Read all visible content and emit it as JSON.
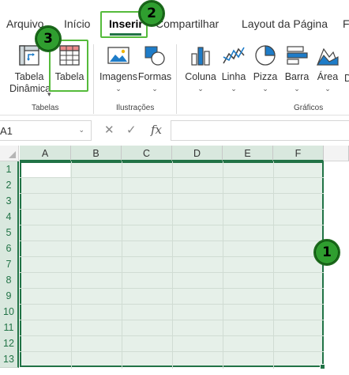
{
  "menu": {
    "tabs": [
      "Arquivo",
      "Início",
      "Inserir",
      "Compartilhar",
      "Layout da Página",
      "F"
    ],
    "active": "Inserir"
  },
  "ribbon": {
    "groups": [
      {
        "label": "Tabelas",
        "buttons": [
          {
            "line1": "Tabela",
            "line2": "Dinâmica",
            "icon": "pivot-table-icon"
          },
          {
            "line1": "Tabela",
            "icon": "table-icon"
          }
        ]
      },
      {
        "label": "Ilustrações",
        "buttons": [
          {
            "line1": "Imagens",
            "icon": "picture-icon"
          },
          {
            "line1": "Formas",
            "icon": "shapes-icon"
          }
        ]
      },
      {
        "label": "Gráficos",
        "buttons": [
          {
            "line1": "Coluna",
            "icon": "column-chart-icon"
          },
          {
            "line1": "Linha",
            "icon": "line-chart-icon"
          },
          {
            "line1": "Pizza",
            "icon": "pie-chart-icon"
          },
          {
            "line1": "Barra",
            "icon": "bar-chart-icon"
          },
          {
            "line1": "Área",
            "icon": "area-chart-icon"
          },
          {
            "line1": "D"
          }
        ]
      }
    ]
  },
  "formula_bar": {
    "name_box": "A1",
    "cancel_symbol": "✕",
    "confirm_symbol": "✓",
    "fx_label": "fx",
    "value": ""
  },
  "sheet": {
    "columns": [
      "A",
      "B",
      "C",
      "D",
      "E",
      "F"
    ],
    "rows": [
      "1",
      "2",
      "3",
      "4",
      "5",
      "6",
      "7",
      "8",
      "9",
      "10",
      "11",
      "12",
      "13"
    ],
    "active_cell": "A1",
    "selected_range": "A1:F13"
  },
  "callouts": [
    "1",
    "2",
    "3"
  ],
  "colors": {
    "accent": "#217346",
    "selection_fill": "#e6f0e9",
    "highlight": "#55bb3b",
    "badge": "#2f9e2f"
  }
}
